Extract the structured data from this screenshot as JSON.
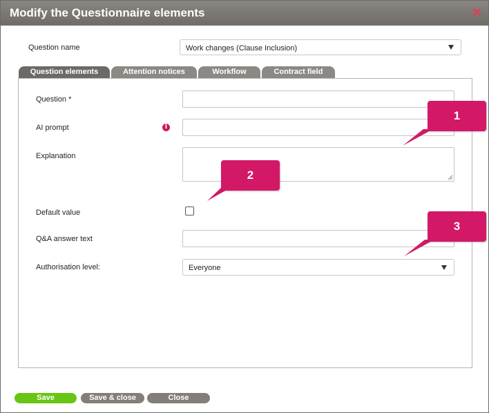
{
  "dialog": {
    "title": "Modify the Questionnaire elements",
    "close_glyph": "✕"
  },
  "question_name": {
    "label": "Question name",
    "value": "Work changes (Clause Inclusion)"
  },
  "tabs": [
    {
      "label": "Question elements"
    },
    {
      "label": "Attention notices"
    },
    {
      "label": "Workflow"
    },
    {
      "label": "Contract field"
    }
  ],
  "form": {
    "question_label": "Question *",
    "ai_prompt_label": "AI prompt",
    "explanation_label": "Explanation",
    "default_value_label": "Default value",
    "qa_answer_label": "Q&A answer text",
    "authorisation_label": "Authorisation level:",
    "authorisation_value": "Everyone",
    "info_glyph": "i"
  },
  "callouts": [
    {
      "label": "1"
    },
    {
      "label": "2"
    },
    {
      "label": "3"
    }
  ],
  "buttons": {
    "save": "Save",
    "save_close": "Save & close",
    "close": "Close"
  },
  "colors": {
    "accent_pink": "#d21866",
    "save_green": "#69c514",
    "titlebar": "#7a7672",
    "tab": "#8c8884"
  }
}
